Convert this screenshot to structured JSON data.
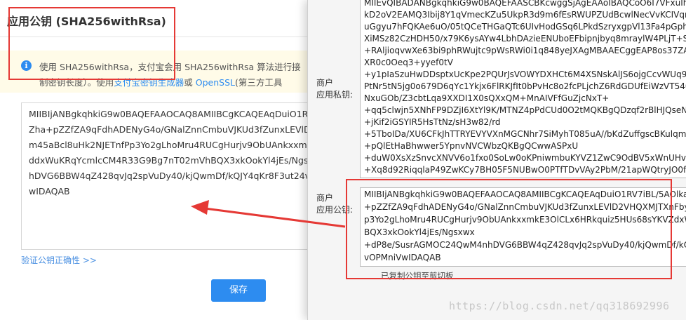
{
  "left_dialog": {
    "title": "应用公钥 (SHA256withRsa)",
    "notice": {
      "line1": "使用 SHA256withRsa，支付宝会用 SHA256withRsa 算法进行接",
      "line2_prefix": "制密钥长度）。使用",
      "link_keygen": "支付宝密钥生成器",
      "line2_mid": "或",
      "link_openssl": "OpenSSL",
      "line2_suffix": "(第三方工具"
    },
    "public_key_lines": [
      "MIIBIjANBgkqhkiG9w0BAQEFAAOCAQ8AMIIBCgKCAQEAqDuiO1R",
      "Zha+pZZfZA9qFdhADENyG4o/GNalZnnCmbuVJKUd3fZunxLEVlD2",
      "m45aBcl8uHk2NJETnfPp3Yo2gLhoMru4RUCgHurjv9ObUAnkxxmk",
      "ddxWuKRqYcmlcCM4R33G9Bg7nT02mVhBQX3xkOokYl4jEs/Ngsx",
      "hDVG6BBW4qZ428qvJq2spVuDy40/kjQwmDf/kQJY4qKr8F3ut24v",
      "wIDAQAB"
    ],
    "verify_link": "验证公钥正确性 >>",
    "save_label": "保存"
  },
  "right_window": {
    "private_key_label": [
      "商户",
      "应用私钥:"
    ],
    "private_key_lines": [
      "MIIEvQIBADANBgkqhkiG9w0BAQEFAASCBKcwggSjAgEAAoIBAQCoO6I7VFxuIh",
      "kD2oV2EAMQ3Ibij8Y1qVmecKZu5UkpR3d9m6fEsRWUPZUdBcwlNecVvKCIVqrx",
      "uGgyu7hFQKAe6uO/05tQCeTHGaQTc6UIvHodGSq6LPkdSzryxgpVl13Fa4pGphyd",
      "XiMSz82CzHDH50/x79K6ysAYw4LbhDAzieENUboEFbipnjbyq8mraylW4PLjT+SNDl",
      "+RAljioqvwXe63bi9phRWujtc9pWsRWi0i1q848yeJXAgMBAAECggEAP8os37ZAxv",
      "XR0c0Oeq3+yyef0tV",
      "+y1pIaSzuHwDDsptxUcKpe2PQUrJsVOWYDXHCt6M4XSNskAlJS6ojgCcvWUq9tw",
      "PtNr5tN5jg0o679D6qYc1Ykjx6FlRKJfIt0bPvHc8o2fcPLjchZ6RdGDUfEiWzVT540r0",
      "NxuGOb/Z3cbtLqa9XXDI1X0sQXxQM+MnAIVFfGuZjcNxT+",
      "+qq5clwjn5XNhFP9DZjI6XtYl9K/MTNZ4pPdCUd0O2tMQKBgQDzqf2rBlHJQseNs",
      "+jKif2iGSYIR5HsTtNz/sH3w82/rd",
      "+5TboIDa/XU6CFkJhTTRYEVYVXnMGCNhr7SiMyhT085uA//bKdZuffgscBKulqmy",
      "+pQlEtHaBhwwer5YpnvNVCWbzQKBgQCwwASPxU",
      "+duW0XsXzSnvcXNVV6o1fxo0SoLw0oKPniwmbuKYVZ1ZwC9OdBV5xWnUHvRo",
      "+Xq8d92RiqqlaP49ZwKCy7BH05F5NUBwO0PTfTDvVAy2PbM/21apWQtryJO0fkC"
    ],
    "public_key_label": [
      "商户",
      "应用公钥:"
    ],
    "public_key_lines": [
      "MIIBIjANBgkqhkiG9w0BAQEFAAOCAQ8AMIIBCgKCAQEAqDuiO1RV7iBL/5AOlka",
      "+pZZfZA9qFdhADENyG4o/GNalZnnCmbuVJKUd3fZunxLEVlD2VHQXMJTXnFbygi",
      "p3Yo2gLhoMru4RUCgHurjv9ObUAnkxxmkE3OlCLx6HRkquiz5HUs68sYKVZdxW",
      "BQX3xkOokYl4jEs/Ngsxwx",
      "+dP8e/SusrAGMOC24QwM4nhDVG6BBW4qZ428qvJq2spVuDy40/kjQwmDf/kQJ",
      "vOPMniVwIDAQAB"
    ],
    "copied_status": "已复制公钥至剪切板"
  },
  "watermark": "https://blog.csdn.net/qq318692996",
  "colors": {
    "annotation_red": "#e53935",
    "primary_blue": "#2d8cf0",
    "link_blue": "#4a90e2"
  }
}
